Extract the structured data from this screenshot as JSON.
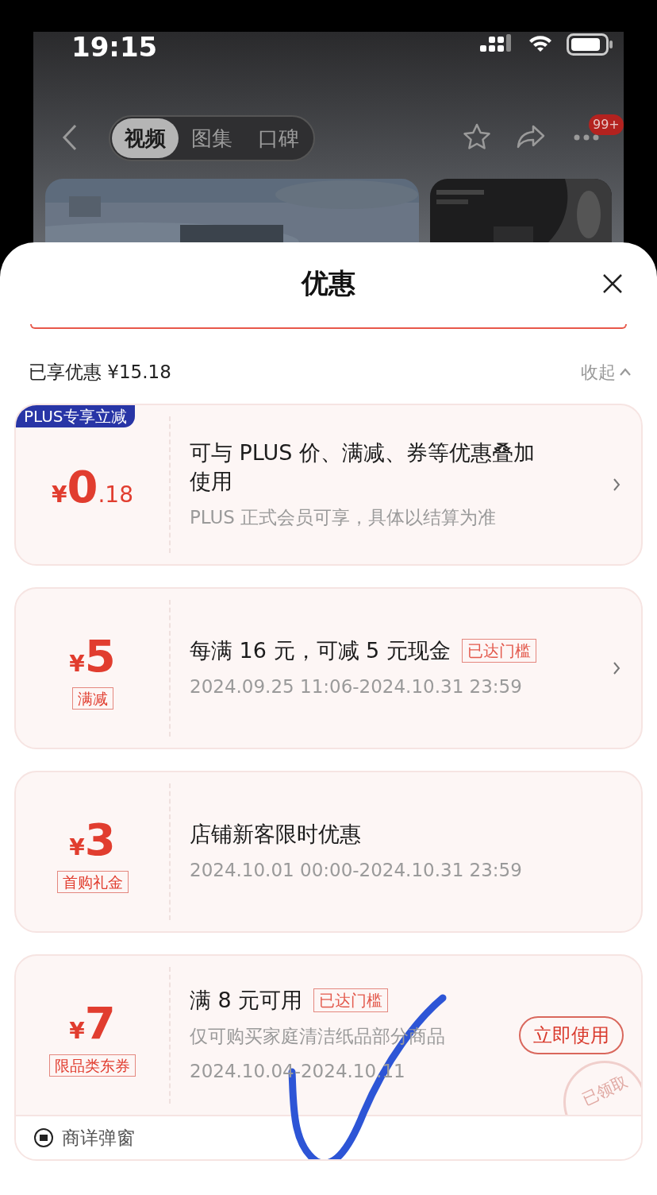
{
  "status_bar": {
    "time": "19:15"
  },
  "nav": {
    "tabs": [
      {
        "label": "视频",
        "selected": true
      },
      {
        "label": "图集",
        "selected": false
      },
      {
        "label": "口碑",
        "selected": false
      }
    ],
    "badge": "99+"
  },
  "sheet": {
    "title": "优惠",
    "summary": "已享优惠 ¥15.18",
    "collapse": "收起"
  },
  "coupons": [
    {
      "badge": "PLUS专享立减",
      "currency": "¥",
      "amount": "0",
      "decimal": ".18",
      "title": "可与 PLUS 价、满减、券等优惠叠加使用",
      "lines": [
        "PLUS 正式会员可享，具体以结算为准"
      ],
      "arrow": true
    },
    {
      "currency": "¥",
      "amount": "5",
      "tag": "满减",
      "title": "每满 16 元，可减 5 元现金",
      "threshold": "已达门槛",
      "lines": [
        "2024.09.25 11:06-2024.10.31 23:59"
      ],
      "arrow": true
    },
    {
      "currency": "¥",
      "amount": "3",
      "tag": "首购礼金",
      "title": "店铺新客限时优惠",
      "lines": [
        "2024.10.01 00:00-2024.10.31 23:59"
      ],
      "arrow": false
    },
    {
      "currency": "¥",
      "amount": "7",
      "tag": "限品类东券",
      "title": "满 8 元可用",
      "threshold": "已达门槛",
      "lines": [
        "仅可购买家庭清洁纸品部分商品",
        "2024.10.04-2024.10.11"
      ],
      "arrow": false,
      "action": "立即使用",
      "stamp": "已领取",
      "footer": "商详弹窗"
    }
  ],
  "annotation": {
    "kind": "checkmark"
  }
}
